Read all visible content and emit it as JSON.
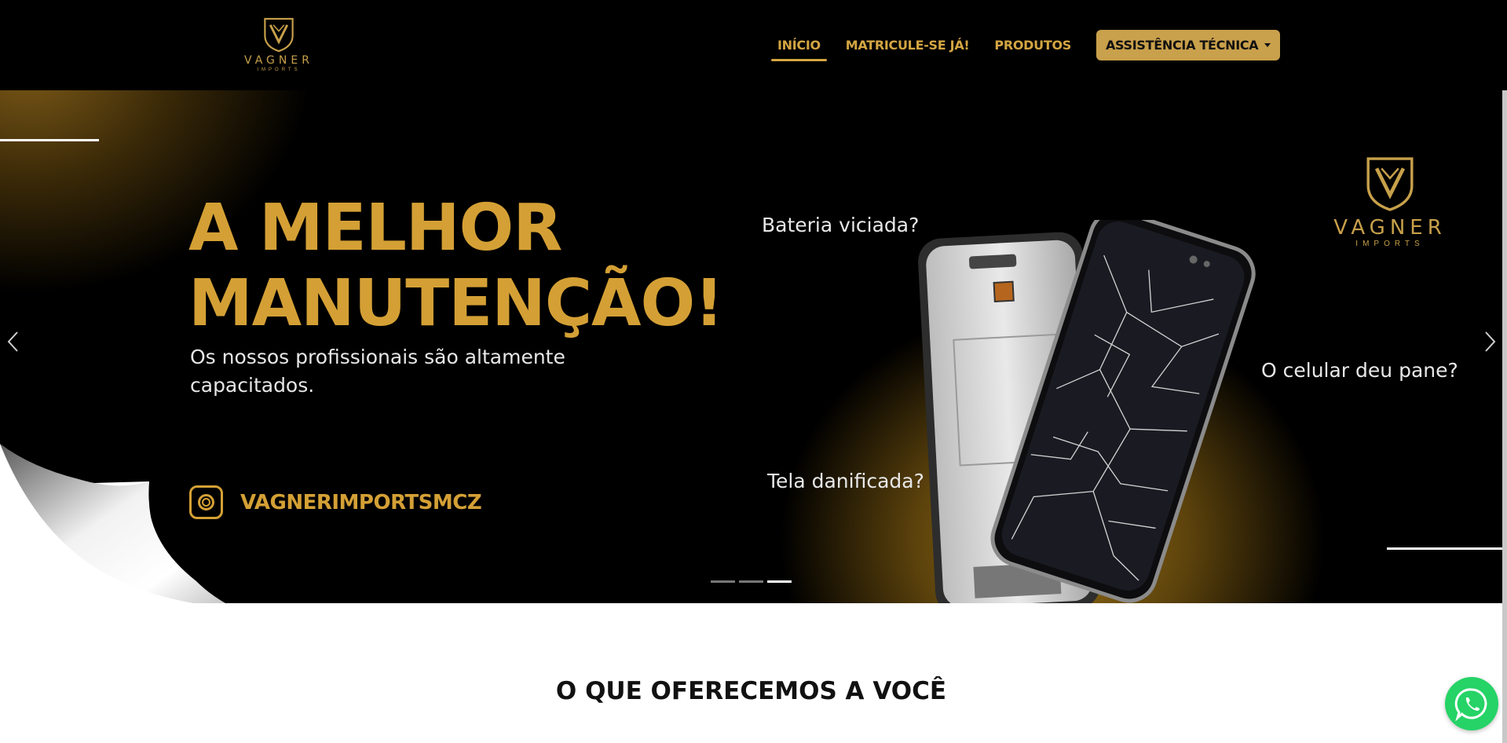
{
  "brand": {
    "name": "VAGNER",
    "sub": "IMPORTS"
  },
  "nav": {
    "items": [
      {
        "label": "INÍCIO",
        "active": true
      },
      {
        "label": "MATRICULE-SE JÁ!",
        "active": false
      },
      {
        "label": "PRODUTOS",
        "active": false
      }
    ],
    "dropdown_label": "ASSISTÊNCIA TÉCNICA"
  },
  "hero": {
    "headline_line1": "A MELHOR",
    "headline_line2": "MANUTENÇÃO!",
    "subtitle": "Os nossos profissionais são altamente capacitados.",
    "instagram_handle": "VAGNERIMPORTSMCZ",
    "question_1": "Bateria viciada?",
    "question_2": "Tela danificada?",
    "question_3": "O celular deu pane?",
    "slides": 3,
    "active_slide": 3
  },
  "section": {
    "title": "O QUE OFERECEMOS A VOCÊ"
  },
  "colors": {
    "gold": "#d4a035",
    "button_gold": "#c9a04b",
    "dark": "#000000",
    "whatsapp": "#25d366"
  }
}
